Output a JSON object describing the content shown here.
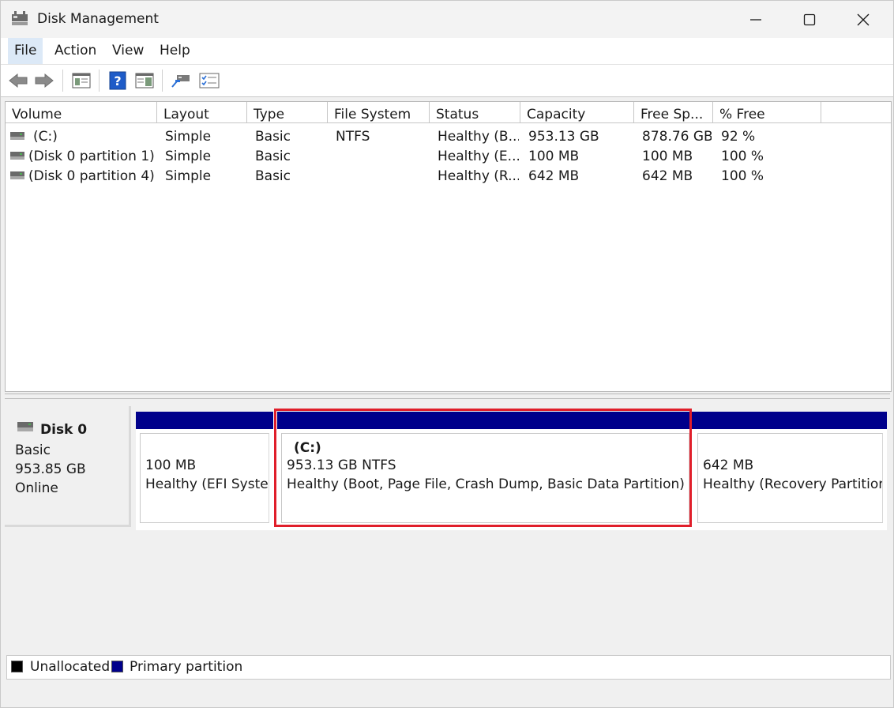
{
  "window": {
    "title": "Disk Management"
  },
  "menu": {
    "items": [
      {
        "label": "File",
        "active": true
      },
      {
        "label": "Action"
      },
      {
        "label": "View"
      },
      {
        "label": "Help"
      }
    ]
  },
  "toolbar": {
    "buttons": [
      "back-icon",
      "forward-icon",
      "properties-icon",
      "help-icon",
      "show-hide-icon",
      "connect-icon",
      "settings-list-icon"
    ]
  },
  "volume_list": {
    "columns": [
      "Volume",
      "Layout",
      "Type",
      "File System",
      "Status",
      "Capacity",
      "Free Sp...",
      "% Free"
    ],
    "rows": [
      {
        "volume": "(C:)",
        "layout": "Simple",
        "type": "Basic",
        "fs": "NTFS",
        "status": "Healthy (B...",
        "capacity": "953.13 GB",
        "free": "878.76 GB",
        "pct": "92 %"
      },
      {
        "volume": "(Disk 0 partition 1)",
        "layout": "Simple",
        "type": "Basic",
        "fs": "",
        "status": "Healthy (E...",
        "capacity": "100 MB",
        "free": "100 MB",
        "pct": "100 %"
      },
      {
        "volume": "(Disk 0 partition 4)",
        "layout": "Simple",
        "type": "Basic",
        "fs": "",
        "status": "Healthy (R...",
        "capacity": "642 MB",
        "free": "642 MB",
        "pct": "100 %"
      }
    ]
  },
  "disk": {
    "name": "Disk 0",
    "type": "Basic",
    "size": "953.85 GB",
    "state": "Online",
    "partitions": [
      {
        "title": "",
        "line1": "100 MB",
        "line2": "Healthy (EFI System Partition)"
      },
      {
        "title": "(C:)",
        "line1": "953.13 GB NTFS",
        "line2": "Healthy (Boot, Page File, Crash Dump, Basic Data Partition)"
      },
      {
        "title": "",
        "line1": "642 MB",
        "line2": "Healthy (Recovery Partition)"
      }
    ]
  },
  "legend": {
    "items": [
      {
        "label": "Unallocated",
        "color": "#000000"
      },
      {
        "label": "Primary partition",
        "color": "#00008b"
      }
    ]
  },
  "colors": {
    "primary_partition": "#00008b",
    "highlight": "#e01e2a"
  }
}
